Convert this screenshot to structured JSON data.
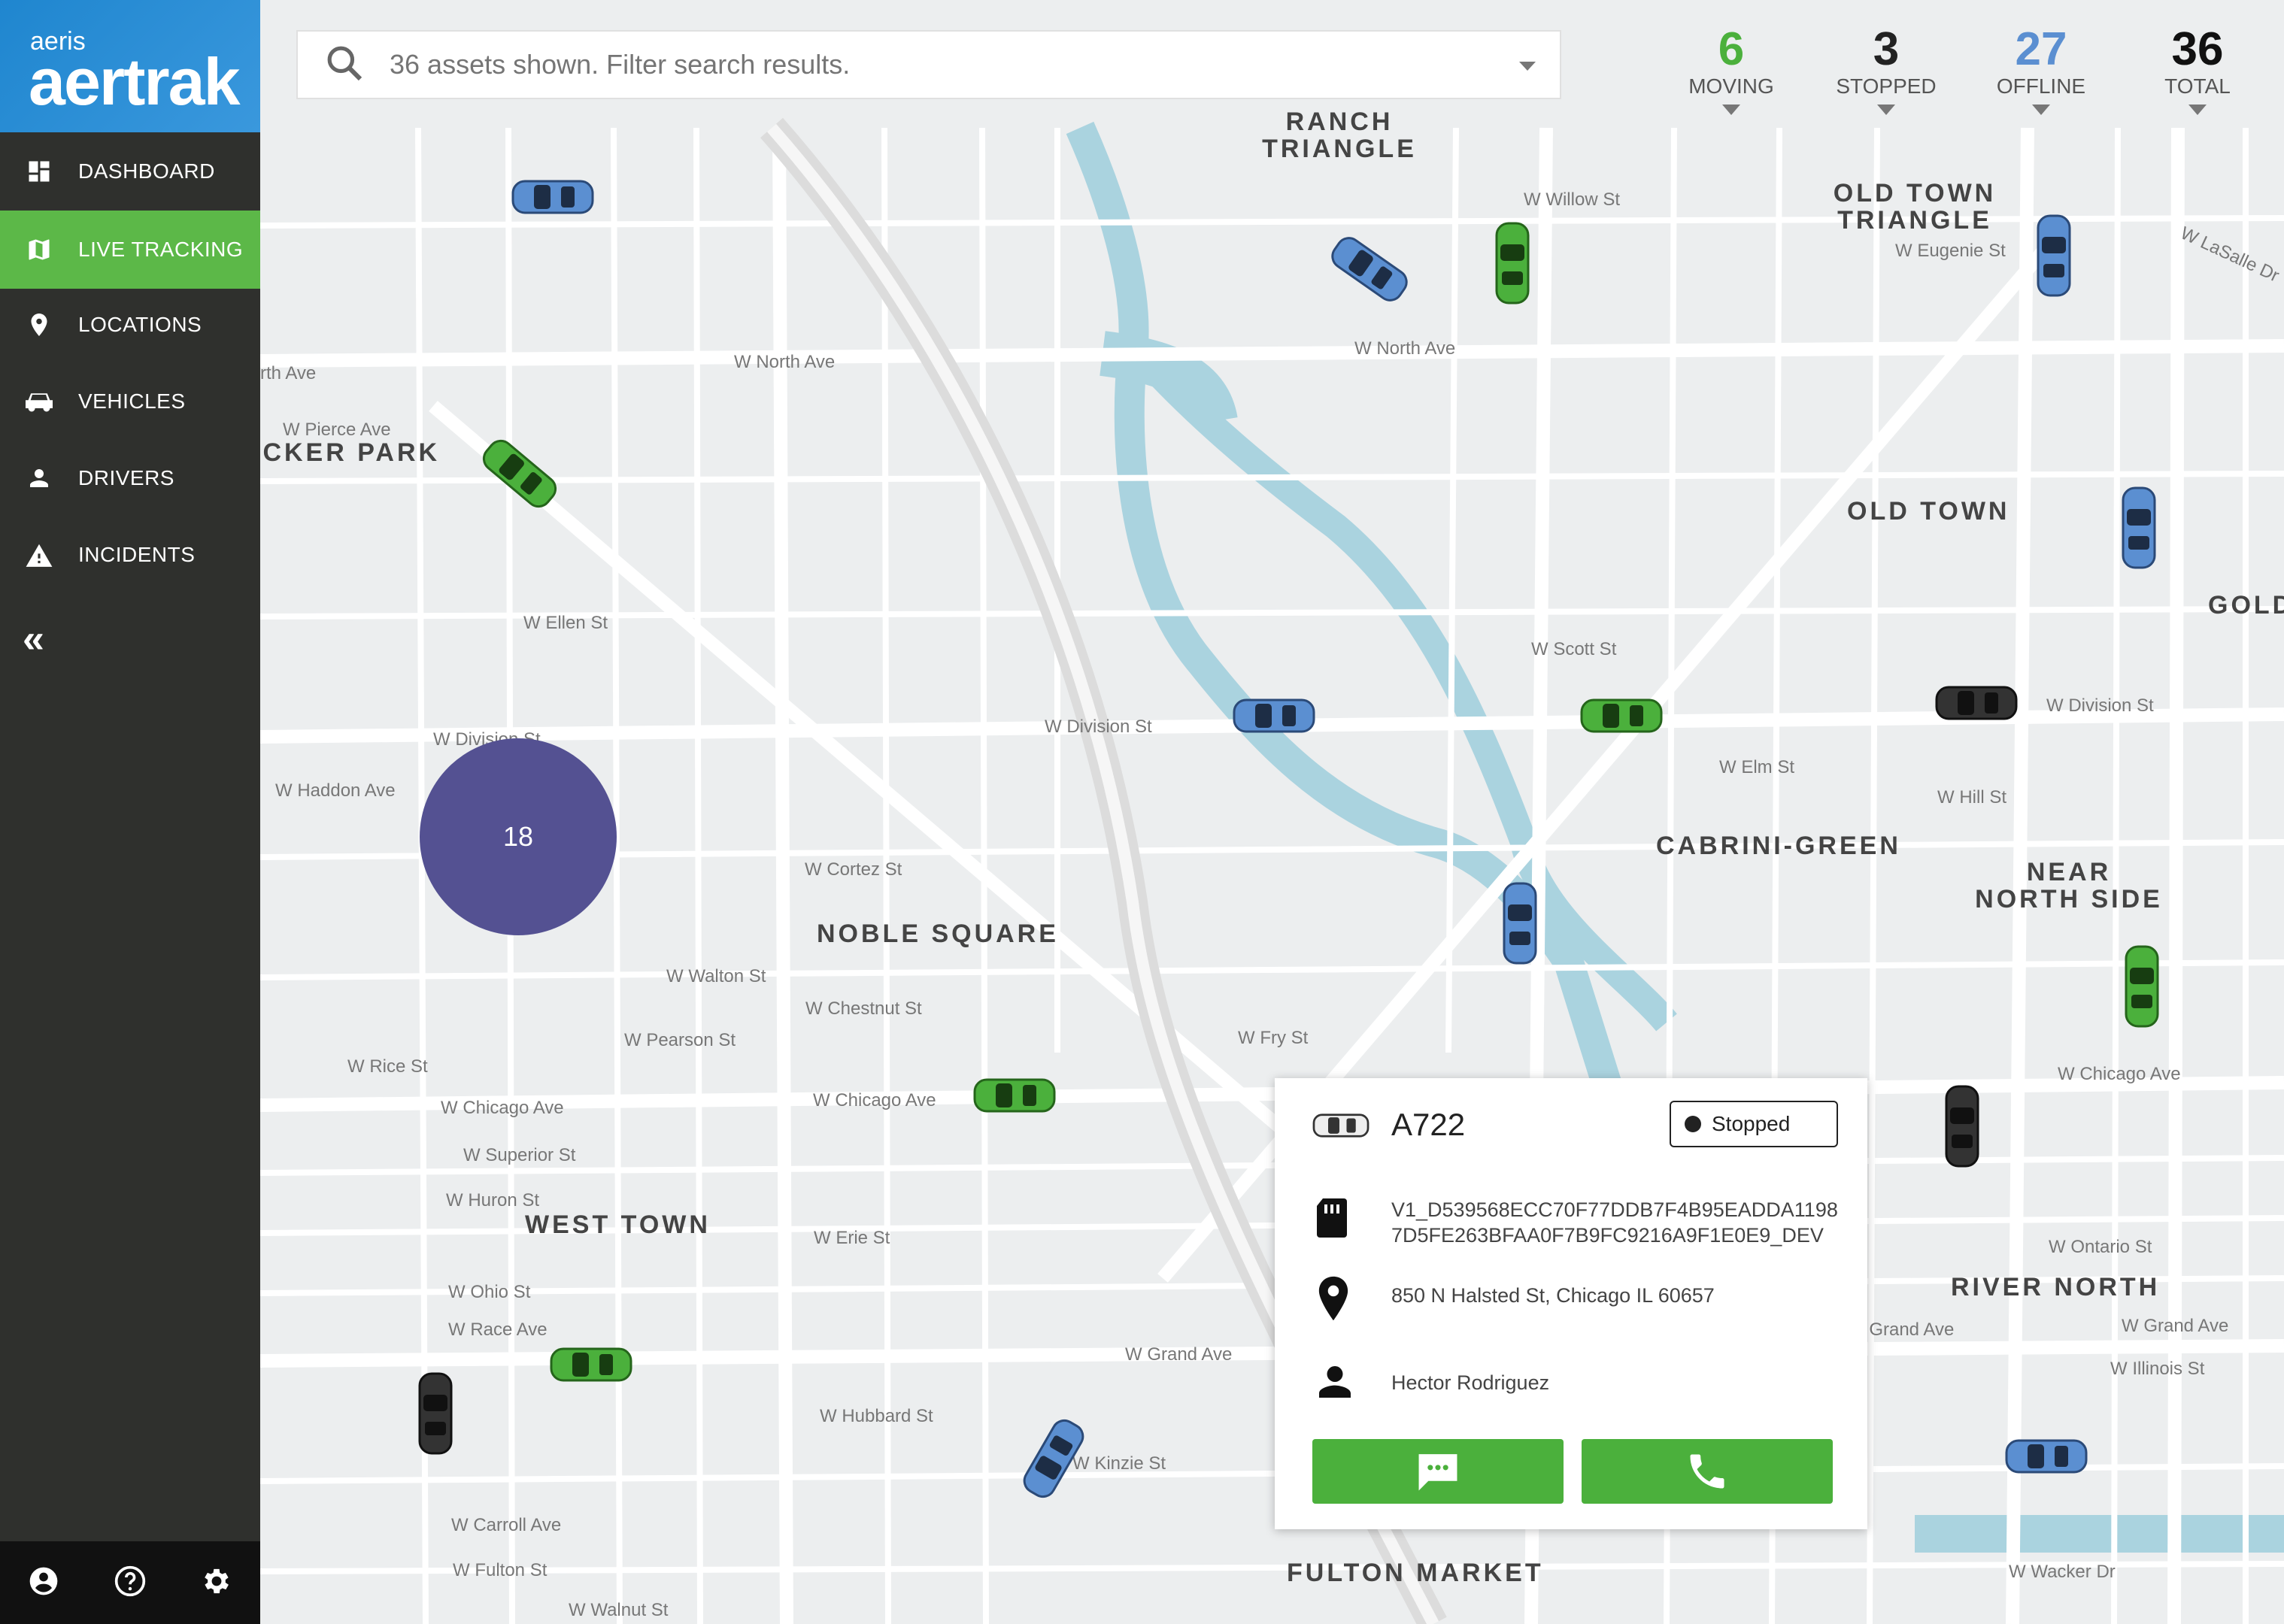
{
  "brand": {
    "sub": "aeris",
    "main": "aertrak"
  },
  "nav": {
    "items": [
      {
        "label": "DASHBOARD",
        "icon": "dashboard-icon",
        "active": false
      },
      {
        "label": "LIVE TRACKING",
        "icon": "map-icon",
        "active": true
      },
      {
        "label": "LOCATIONS",
        "icon": "location-pin-icon",
        "active": false
      },
      {
        "label": "VEHICLES",
        "icon": "car-icon",
        "active": false
      },
      {
        "label": "DRIVERS",
        "icon": "person-icon",
        "active": false
      },
      {
        "label": "INCIDENTS",
        "icon": "warning-icon",
        "active": false
      }
    ],
    "collapse": "«"
  },
  "search": {
    "placeholder": "36 assets shown. Filter search results."
  },
  "stats": {
    "moving": {
      "value": "6",
      "label": "MOVING",
      "color": "#4bb03c"
    },
    "stopped": {
      "value": "3",
      "label": "STOPPED",
      "color": "#222222"
    },
    "offline": {
      "value": "27",
      "label": "OFFLINE",
      "color": "#5b8fd1"
    },
    "total": {
      "value": "36",
      "label": "TOTAL",
      "color": "#111111"
    }
  },
  "map": {
    "cluster": "18",
    "areas": {
      "ranch1": "RANCH",
      "ranch2": "TRIANGLE",
      "oldtowntri1": "OLD TOWN",
      "oldtowntri2": "TRIANGLE",
      "wicker": "ICKER PARK",
      "oldtown": "OLD TOWN",
      "gold": "GOLD",
      "cabrini": "CABRINI-GREEN",
      "nearnorth1": "NEAR",
      "nearnorth2": "NORTH SIDE",
      "noble": "NOBLE SQUARE",
      "westtown": "WEST TOWN",
      "rivernorth": "RIVER NORTH",
      "fulton": "FULTON MARKET"
    },
    "streets": {
      "northave1": "W North Ave",
      "northave2": "W North Ave",
      "northave3": "rth Ave",
      "division1": "W Division St",
      "division2": "W Division St",
      "division3": "W Division St",
      "chicago1": "W Chicago Ave",
      "chicago2": "W Chicago Ave",
      "chicago3": "W Chicago Ave",
      "grand1": "W Grand Ave",
      "grand2": "W Grand Ave",
      "grand3": "W Grand Ave",
      "hubbard": "W Hubbard St",
      "kinzie": "W Kinzie St",
      "carroll": "W Carroll Ave",
      "fulton": "W Fulton St",
      "walnut": "W Walnut St",
      "superior": "W Superior St",
      "huron": "W Huron St",
      "erie": "W Erie St",
      "ohio": "W Ohio St",
      "race": "W Race Ave",
      "rice": "W Rice St",
      "walton": "W Walton St",
      "chestnut": "W Chestnut St",
      "pearson": "W Pearson St",
      "cortez": "W Cortez St",
      "haddon": "W Haddon Ave",
      "ellen": "W Ellen St",
      "pierce": "W Pierce Ave",
      "willow": "W Willow St",
      "scott": "W Scott St",
      "elm": "W Elm St",
      "hill": "W Hill St",
      "fry": "W Fry St",
      "wacker": "W Wacker Dr",
      "eugenie": "W Eugenie St",
      "lasalle": "W LaSalle Dr",
      "ontario": "W Ontario St",
      "illinois": "W Illinois St"
    }
  },
  "popup": {
    "vehicle_id": "A722",
    "status": "Stopped",
    "device_line1": "V1_D539568ECC70F77DDB7F4B95EADDA1198",
    "device_line2": "7D5FE263BFAA0F7B9FC9216A9F1E0E9_DEV",
    "address": "850 N Halsted St, Chicago IL 60657",
    "driver": "Hector Rodriguez"
  },
  "colors": {
    "green": "#4bb03c",
    "blue": "#5b8fd1",
    "black": "#333333",
    "sidebar": "#2f302d"
  }
}
